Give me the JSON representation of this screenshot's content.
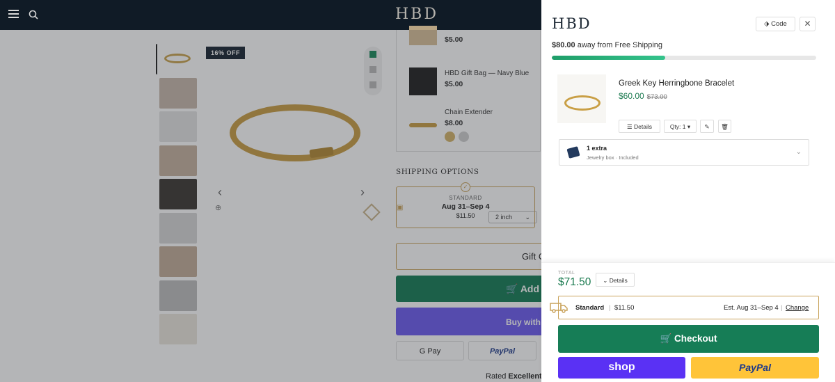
{
  "header": {
    "logo": "HBD",
    "menu_icon": "hamburger-icon",
    "search_icon": "search-icon"
  },
  "product": {
    "badge": "16% OFF",
    "thumbnails_count": 9
  },
  "addons": [
    {
      "name": "",
      "price": "$5.00"
    },
    {
      "name": "HBD Gift Bag — Navy Blue",
      "price": "$5.00"
    },
    {
      "name": "Chain Extender",
      "price": "$8.00",
      "length_option": "2 inch"
    }
  ],
  "shipping": {
    "title": "SHIPPING OPTIONS",
    "label": "STANDARD",
    "dates": "Aug 31–Sep 4",
    "price": "$11.50"
  },
  "buttons": {
    "gift": "Gift C",
    "add": "Add t",
    "buy_with": "Buy with",
    "gpay": "G Pay",
    "paypal_small": "PayPal"
  },
  "rated": {
    "prefix": "Rated",
    "word": "Excellent"
  },
  "cart": {
    "logo": "HBD",
    "code_button": "Code",
    "close_icon": "close-icon",
    "free_shipping": {
      "amount": "$80.00",
      "text": "away from Free Shipping",
      "progress": 0.43
    },
    "item": {
      "name": "Greek Key Herringbone Bracelet",
      "price": "$60.00",
      "compare_price": "$73.00",
      "details_label": "Details",
      "qty_label": "Qty: 1"
    },
    "extra": {
      "title": "1 extra",
      "subtitle": "Jewelry box · Included"
    },
    "footer": {
      "total_label": "TOTAL",
      "total": "$71.50",
      "details_label": "Details",
      "ship_method": "Standard",
      "ship_cost": "$11.50",
      "ship_est": "Est. Aug 31–Sep 4",
      "change": "Change",
      "checkout": "Checkout",
      "shop_pay": "shop",
      "paypal": "PayPal"
    }
  },
  "colors": {
    "accent_green": "#167d56",
    "gold": "#c9a35b",
    "shop_purple": "#5a31f4",
    "paypal_yellow": "#ffc439"
  }
}
